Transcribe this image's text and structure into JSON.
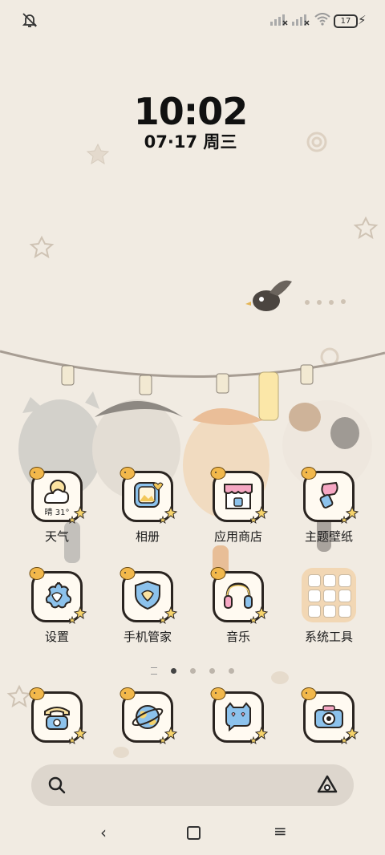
{
  "status_bar": {
    "battery_level": "17",
    "icons": [
      "bell-off-icon",
      "signal-icon",
      "signal-icon",
      "wifi-icon",
      "battery-icon",
      "charging-icon"
    ]
  },
  "clock": {
    "time": "10:02",
    "date": "07·17  周三"
  },
  "weather_widget": {
    "text": "晴 31°"
  },
  "apps_row1": [
    {
      "label": "天气",
      "icon": "weather-icon"
    },
    {
      "label": "相册",
      "icon": "gallery-icon"
    },
    {
      "label": "应用商店",
      "icon": "store-icon"
    },
    {
      "label": "主题壁纸",
      "icon": "theme-icon"
    }
  ],
  "apps_row2": [
    {
      "label": "设置",
      "icon": "settings-icon"
    },
    {
      "label": "手机管家",
      "icon": "security-icon"
    },
    {
      "label": "音乐",
      "icon": "headphones-icon"
    },
    {
      "label": "系统工具",
      "icon": "folder-icon"
    }
  ],
  "dock": [
    {
      "icon": "phone-icon"
    },
    {
      "icon": "browser-icon"
    },
    {
      "icon": "messages-icon"
    },
    {
      "icon": "camera-icon"
    }
  ],
  "page_indicator": {
    "pages": 4,
    "current": 1
  },
  "colors": {
    "background": "#f1ebe2",
    "tile_border": "#2a2420",
    "tile_fill": "#fffaf1",
    "accent_blue": "#4a90d9",
    "chick": "#f2b84b"
  }
}
